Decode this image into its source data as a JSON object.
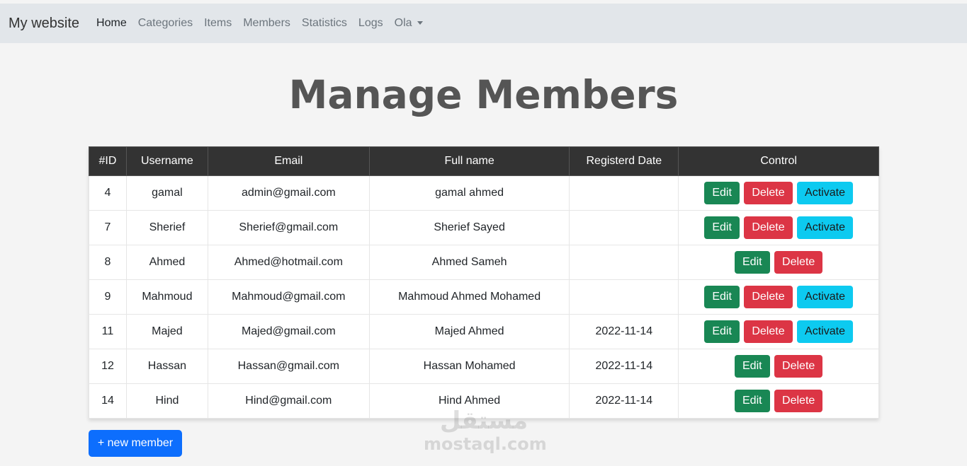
{
  "nav": {
    "brand": "My website",
    "links": [
      "Home",
      "Categories",
      "Items",
      "Members",
      "Statistics",
      "Logs"
    ],
    "user_menu": "Ola"
  },
  "page_title": "Manage Members",
  "table": {
    "headers": [
      "#ID",
      "Username",
      "Email",
      "Full name",
      "Registerd Date",
      "Control"
    ],
    "rows": [
      {
        "id": "4",
        "username": "gamal",
        "email": "admin@gmail.com",
        "fullname": "gamal ahmed",
        "date": "",
        "activate": true
      },
      {
        "id": "7",
        "username": "Sherief",
        "email": "Sherief@gmail.com",
        "fullname": "Sherief Sayed",
        "date": "",
        "activate": true
      },
      {
        "id": "8",
        "username": "Ahmed",
        "email": "Ahmed@hotmail.com",
        "fullname": "Ahmed Sameh",
        "date": "",
        "activate": false
      },
      {
        "id": "9",
        "username": "Mahmoud",
        "email": "Mahmoud@gmail.com",
        "fullname": "Mahmoud Ahmed Mohamed",
        "date": "",
        "activate": true
      },
      {
        "id": "11",
        "username": "Majed",
        "email": "Majed@gmail.com",
        "fullname": "Majed Ahmed",
        "date": "2022-11-14",
        "activate": true
      },
      {
        "id": "12",
        "username": "Hassan",
        "email": "Hassan@gmail.com",
        "fullname": "Hassan Mohamed",
        "date": "2022-11-14",
        "activate": false
      },
      {
        "id": "14",
        "username": "Hind",
        "email": "Hind@gmail.com",
        "fullname": "Hind Ahmed",
        "date": "2022-11-14",
        "activate": false
      }
    ],
    "edit_label": "Edit",
    "delete_label": "Delete",
    "activate_label": "Activate"
  },
  "new_member_label": "+ new member",
  "watermark": {
    "logo": "مستقل",
    "text": "mostaql.com"
  },
  "colors": {
    "edit": "#198754",
    "delete": "#dc3545",
    "activate": "#0dcaf0",
    "primary": "#0d6efd",
    "table_header": "#333333",
    "navbar": "#e2e6ea"
  }
}
